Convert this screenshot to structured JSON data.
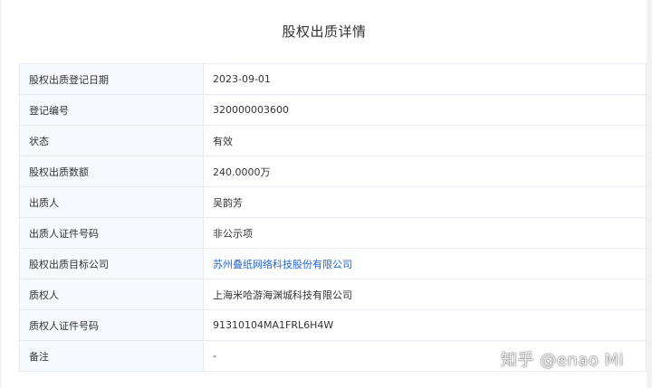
{
  "page": {
    "title": "股权出质详情"
  },
  "rows": [
    {
      "label": "股权出质登记日期",
      "value": "2023-09-01",
      "link": false
    },
    {
      "label": "登记编号",
      "value": "320000003600",
      "link": false
    },
    {
      "label": "状态",
      "value": "有效",
      "link": false
    },
    {
      "label": "股权出质数额",
      "value": "240.0000万",
      "link": false
    },
    {
      "label": "出质人",
      "value": "吴韵芳",
      "link": false
    },
    {
      "label": "出质人证件号码",
      "value": "非公示项",
      "link": false
    },
    {
      "label": "股权出质目标公司",
      "value": "苏州叠纸网络科技股份有限公司",
      "link": true
    },
    {
      "label": "质权人",
      "value": "上海米哈游海渊城科技有限公司",
      "link": false
    },
    {
      "label": "质权人证件号码",
      "value": "91310104MA1FRL6H4W",
      "link": false
    },
    {
      "label": "备注",
      "value": "-",
      "link": false
    }
  ],
  "watermark": {
    "text": "知乎 @enao Mi"
  },
  "colors": {
    "link": "#2366c6",
    "label_bg": "#f6f9fd",
    "border": "#e8ecf2",
    "page_bg": "#f1f2f4"
  }
}
